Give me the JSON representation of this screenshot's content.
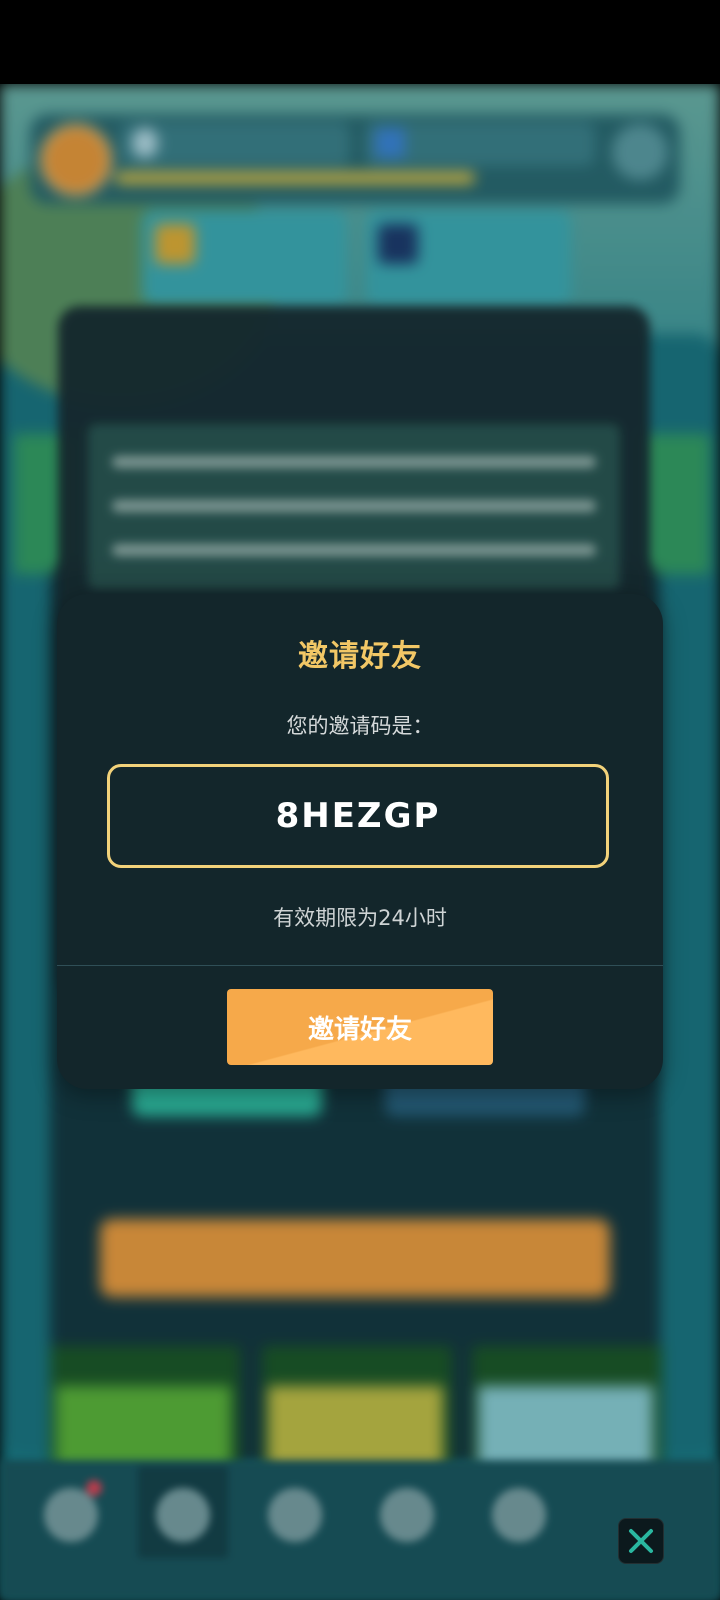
{
  "dialog": {
    "title": "邀请好友",
    "invite_label": "您的邀请码是：",
    "invite_code": "8HEZGP",
    "validity": "有效期限为24小时",
    "invite_button": "邀请好友"
  },
  "colors": {
    "dialog_bg": "#13262b",
    "title_gold": "#f2c766",
    "code_border": "#f2d27a",
    "button_orange": "#f6a94a"
  },
  "icons": {
    "close": "close-x-icon"
  }
}
